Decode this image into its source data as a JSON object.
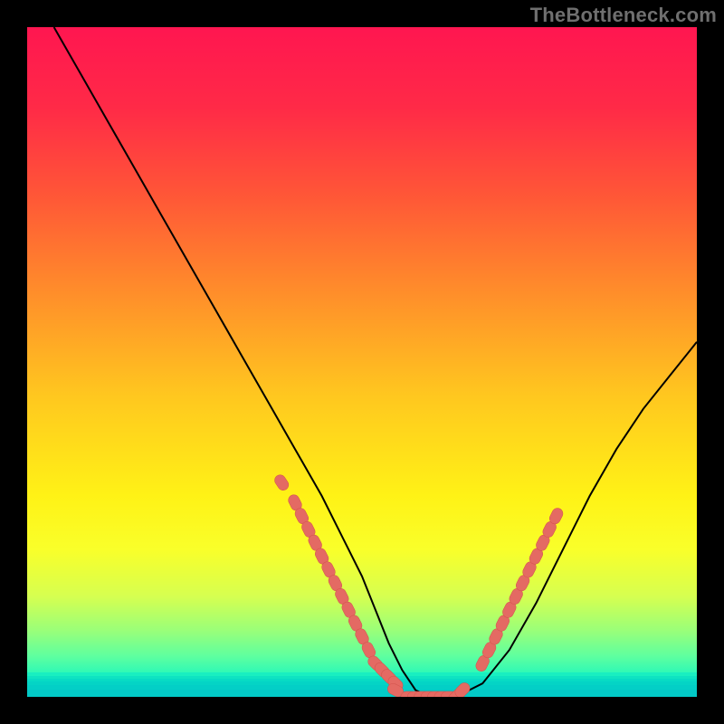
{
  "watermark": "TheBottleneck.com",
  "colors": {
    "frame": "#000000",
    "curve": "#000000",
    "marker_fill": "#e46a63",
    "marker_stroke": "#d2524b",
    "gradient_stops": [
      {
        "offset": 0.0,
        "color": "#ff1650"
      },
      {
        "offset": 0.12,
        "color": "#ff2a47"
      },
      {
        "offset": 0.25,
        "color": "#ff5637"
      },
      {
        "offset": 0.4,
        "color": "#ff8f2a"
      },
      {
        "offset": 0.55,
        "color": "#ffc71f"
      },
      {
        "offset": 0.7,
        "color": "#fff216"
      },
      {
        "offset": 0.78,
        "color": "#f9ff2a"
      },
      {
        "offset": 0.85,
        "color": "#d6ff50"
      },
      {
        "offset": 0.9,
        "color": "#9bff78"
      },
      {
        "offset": 0.94,
        "color": "#5dffa0"
      },
      {
        "offset": 0.97,
        "color": "#23f7bb"
      },
      {
        "offset": 1.0,
        "color": "#05e8c3"
      }
    ]
  },
  "chart_data": {
    "type": "line",
    "title": "",
    "xlabel": "",
    "ylabel": "",
    "xlim": [
      0,
      100
    ],
    "ylim": [
      0,
      100
    ],
    "grid": false,
    "legend": false,
    "series": [
      {
        "name": "bottleneck-curve",
        "x": [
          4,
          8,
          12,
          16,
          20,
          24,
          28,
          32,
          36,
          40,
          44,
          48,
          50,
          52,
          54,
          56,
          58,
          60,
          62,
          64,
          68,
          72,
          76,
          80,
          84,
          88,
          92,
          96,
          100
        ],
        "y": [
          100,
          93,
          86,
          79,
          72,
          65,
          58,
          51,
          44,
          37,
          30,
          22,
          18,
          13,
          8,
          4,
          1,
          0,
          0,
          0,
          2,
          7,
          14,
          22,
          30,
          37,
          43,
          48,
          53
        ]
      }
    ],
    "markers": [
      {
        "name": "left-cluster",
        "x": [
          38,
          40,
          41,
          42,
          43,
          44,
          45,
          46,
          47,
          48,
          49,
          50,
          51,
          52,
          53,
          54,
          55
        ],
        "y": [
          32,
          29,
          27,
          25,
          23,
          21,
          19,
          17,
          15,
          13,
          11,
          9,
          7,
          5,
          4,
          3,
          2
        ]
      },
      {
        "name": "bottom-flat",
        "x": [
          55,
          57,
          58,
          59,
          60,
          61,
          62,
          63,
          64,
          65
        ],
        "y": [
          1,
          0,
          0,
          0,
          0,
          0,
          0,
          0,
          0,
          1
        ]
      },
      {
        "name": "right-cluster",
        "x": [
          68,
          69,
          70,
          71,
          72,
          73,
          74,
          75,
          76,
          77,
          78,
          79
        ],
        "y": [
          5,
          7,
          9,
          11,
          13,
          15,
          17,
          19,
          21,
          23,
          25,
          27
        ]
      }
    ]
  }
}
